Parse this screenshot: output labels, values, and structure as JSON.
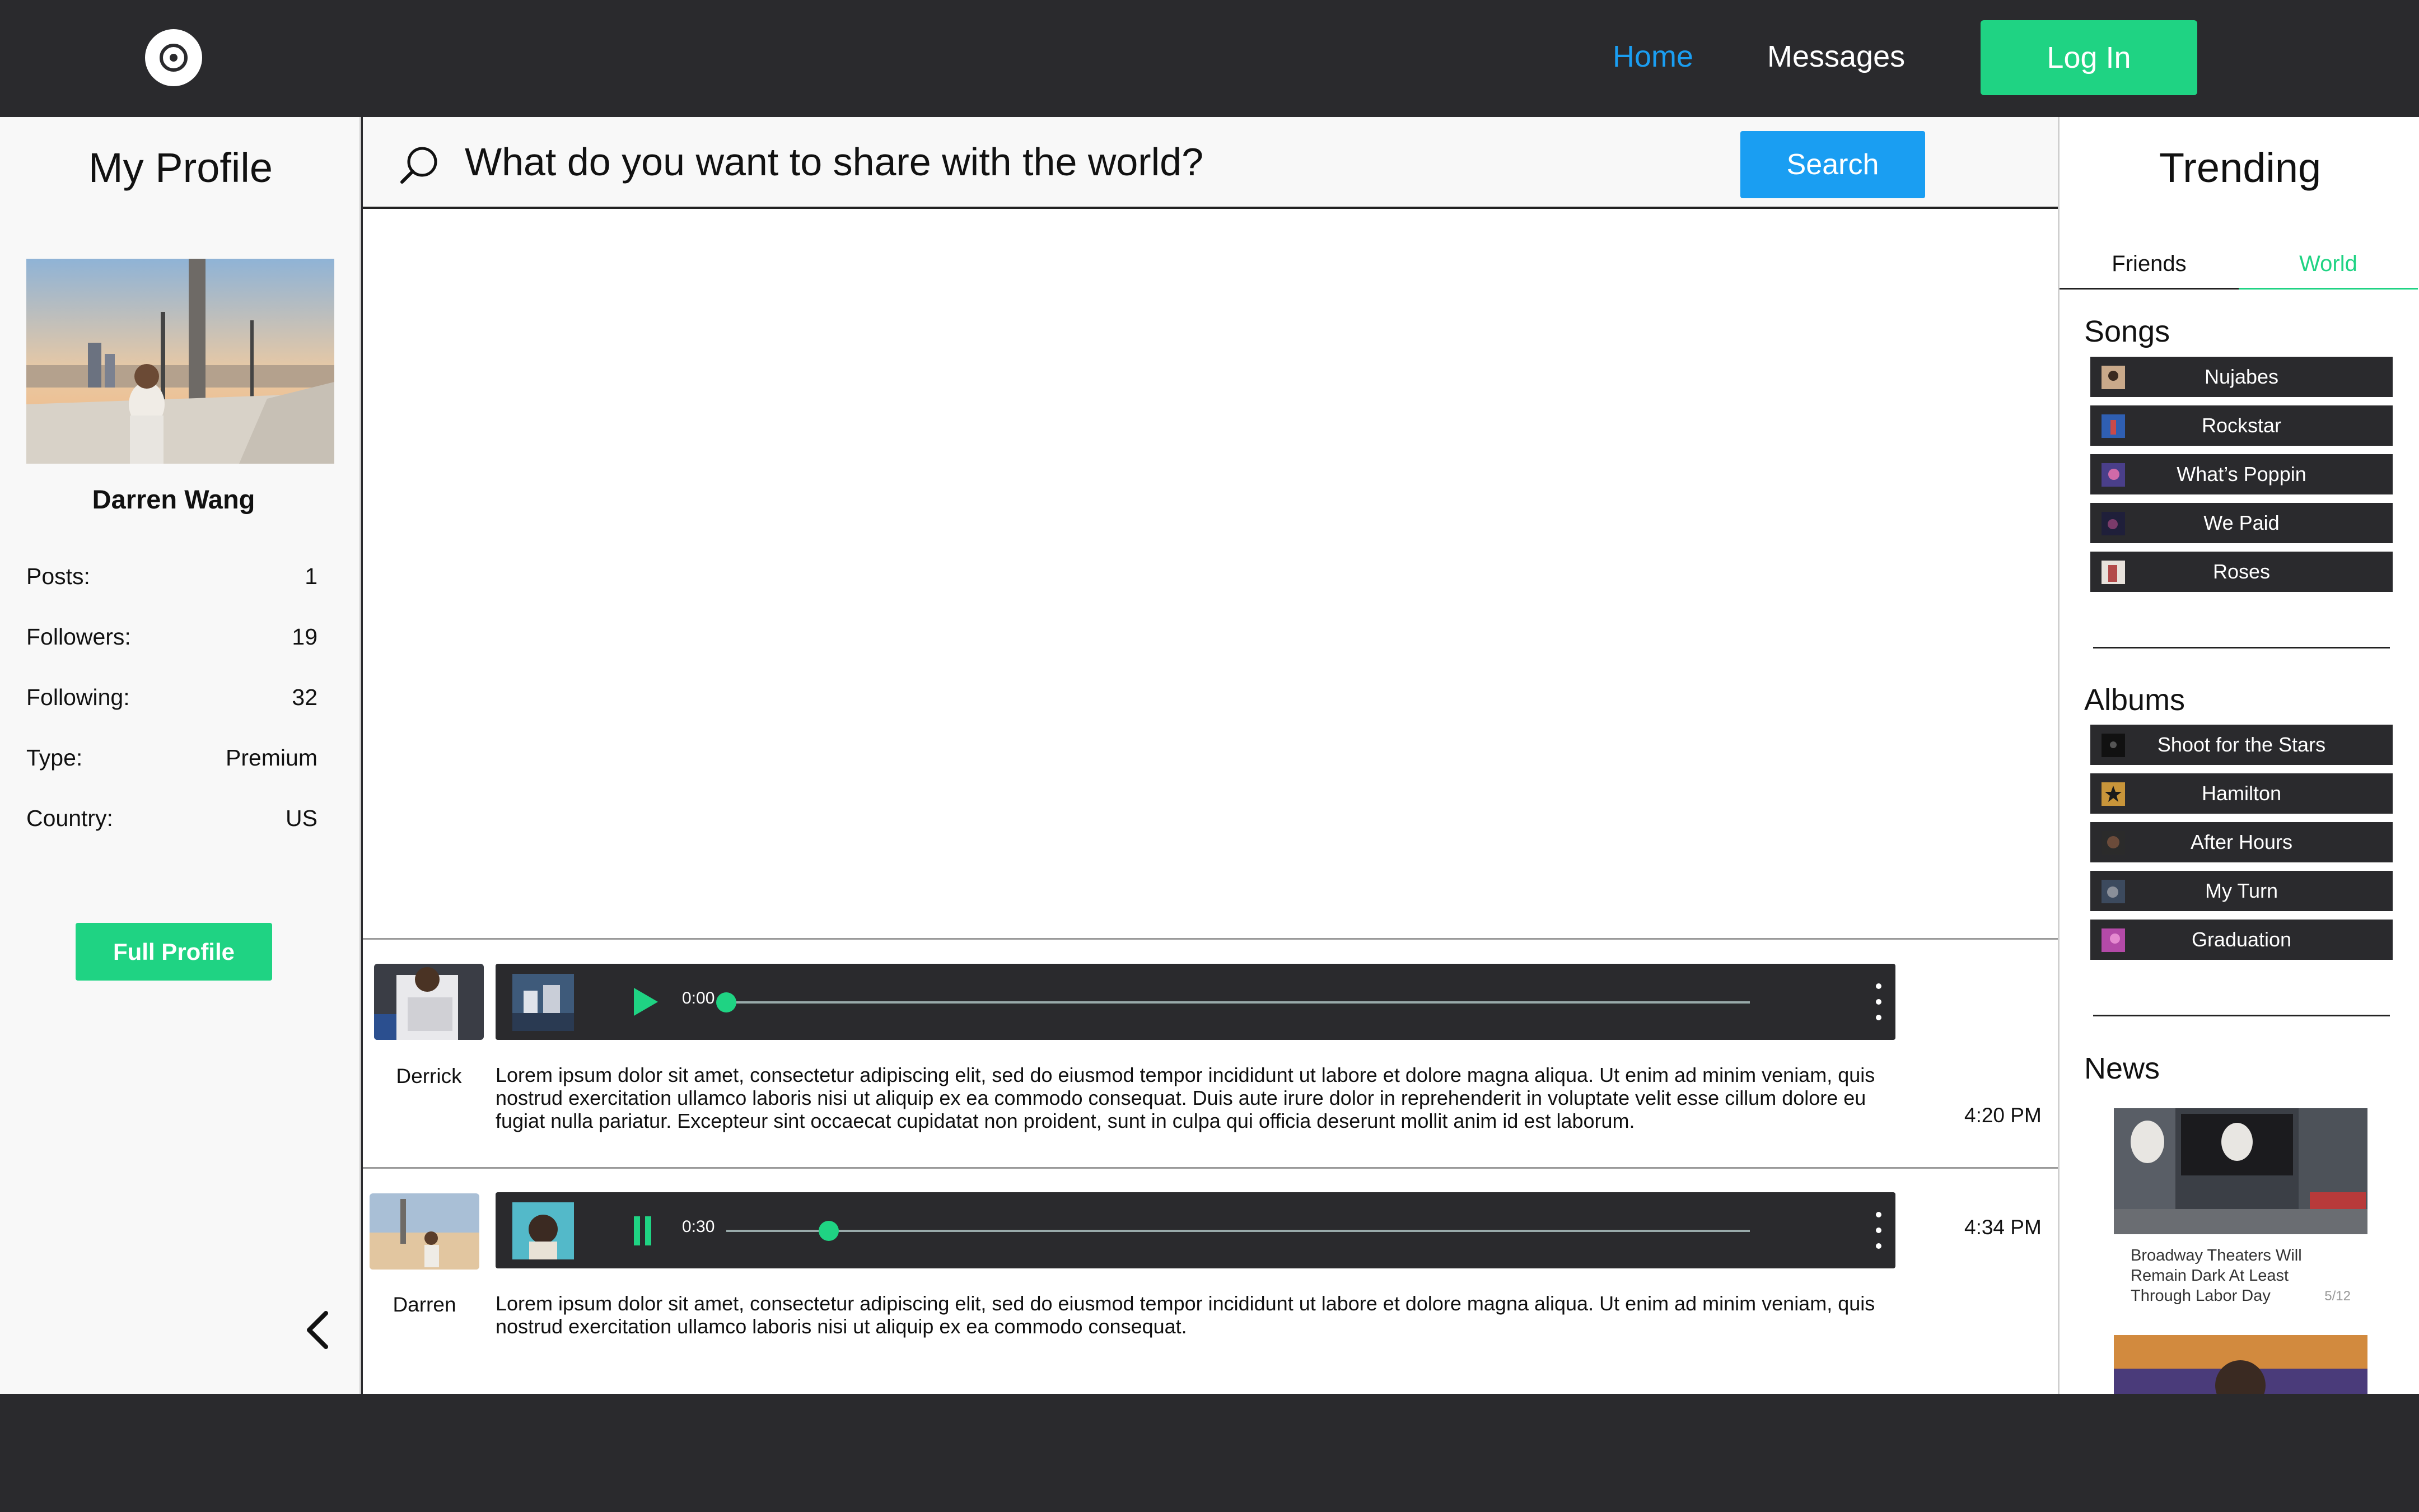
{
  "nav": {
    "home": "Home",
    "messages": "Messages",
    "login": "Log In"
  },
  "profile": {
    "title": "My Profile",
    "name": "Darren Wang",
    "stats": [
      {
        "label": "Posts:",
        "value": "1"
      },
      {
        "label": "Followers:",
        "value": "19"
      },
      {
        "label": "Following:",
        "value": "32"
      },
      {
        "label": "Type:",
        "value": "Premium"
      },
      {
        "label": "Country:",
        "value": "US"
      }
    ],
    "full_profile_label": "Full Profile"
  },
  "search": {
    "placeholder": "What do you want to share with the world?",
    "button": "Search"
  },
  "posts": [
    {
      "user": "Derrick",
      "time": "4:20 PM",
      "player_time": "0:00",
      "playing": false,
      "progress": 0.0,
      "text": "Lorem ipsum dolor sit amet, consectetur adipiscing elit, sed do eiusmod tempor incididunt ut labore et dolore magna aliqua. Ut enim ad minim veniam, quis nostrud exercitation ullamco laboris nisi ut aliquip ex ea commodo consequat. Duis aute irure dolor in reprehenderit in voluptate velit esse cillum dolore eu fugiat nulla pariatur. Excepteur sint occaecat cupidatat non proident, sunt in culpa qui officia deserunt mollit anim id est laborum."
    },
    {
      "user": "Darren",
      "time": "4:34 PM",
      "player_time": "0:30",
      "playing": true,
      "progress": 0.1,
      "text": "Lorem ipsum dolor sit amet, consectetur adipiscing elit, sed do eiusmod tempor incididunt ut labore et dolore magna aliqua. Ut enim ad minim veniam, quis nostrud exercitation ullamco laboris nisi ut aliquip ex ea commodo consequat."
    }
  ],
  "trending": {
    "title": "Trending",
    "tabs": [
      "Friends",
      "World"
    ],
    "active_tab": "World",
    "songs_title": "Songs",
    "songs": [
      "Nujabes",
      "Rockstar",
      "What’s Poppin",
      "We Paid",
      "Roses"
    ],
    "albums_title": "Albums",
    "albums": [
      "Shoot for the Stars",
      "Hamilton",
      "After Hours",
      "My Turn",
      "Graduation"
    ],
    "news_title": "News",
    "news": [
      {
        "caption": "Broadway Theaters Will Remain Dark At Least Through Labor Day",
        "page": "5/12"
      }
    ]
  },
  "colors": {
    "dark": "#2a2a2d",
    "accent_green": "#1fd383",
    "accent_blue": "#1a9ef2"
  }
}
